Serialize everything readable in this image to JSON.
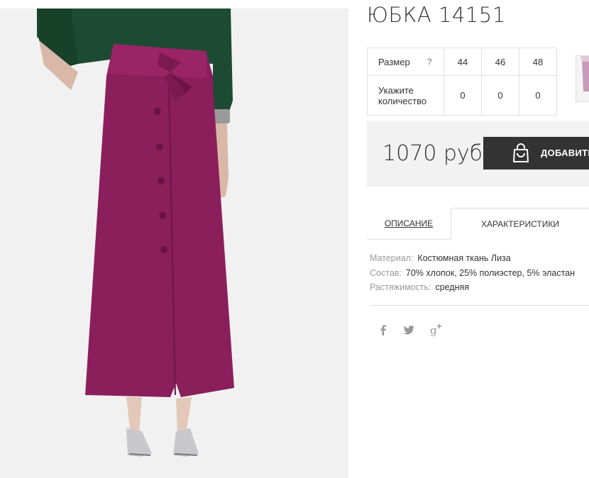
{
  "product": {
    "title": "ЮБКА 14151",
    "price": "1070 руб",
    "add_to_cart_label": "ДОБАВИТЬ"
  },
  "size_table": {
    "size_label": "Размер",
    "help_symbol": "?",
    "sizes": [
      "44",
      "46",
      "48"
    ],
    "quantity_label_line1": "Укажите",
    "quantity_label_line2": "количество",
    "quantities": [
      "0",
      "0",
      "0"
    ]
  },
  "tabs": [
    {
      "label": "ОПИСАНИЕ",
      "active": false
    },
    {
      "label": "ХАРАКТЕРИСТИКИ",
      "active": true
    }
  ],
  "characteristics": [
    {
      "key": "Материал:",
      "value": "Костюмная ткань Лиза"
    },
    {
      "key": "Состав:",
      "value": "70% хлопок, 25% полиэстер, 5% эластан"
    },
    {
      "key": "Растяжимость:",
      "value": "средняя"
    }
  ],
  "social_icons": [
    "facebook-icon",
    "twitter-icon",
    "google-plus-icon"
  ],
  "colors": {
    "skirt": "#8b1f5c",
    "button_bg": "#333333",
    "buybox_bg": "#f2f2f2",
    "muted_text": "#999999"
  }
}
